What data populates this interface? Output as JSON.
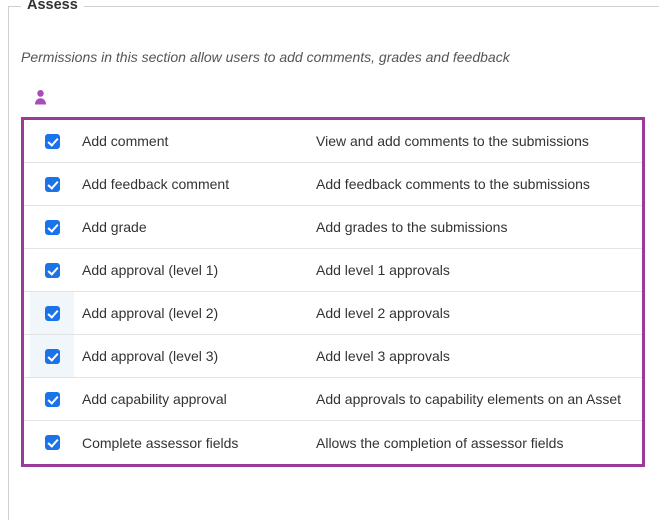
{
  "section": {
    "title": "Assess",
    "description": "Permissions in this section allow users to add comments, grades and feedback"
  },
  "roleIcon": "user-role-icon",
  "permissions": [
    {
      "checked": true,
      "name": "Add comment",
      "desc": "View and add comments to the submissions",
      "highlight": false
    },
    {
      "checked": true,
      "name": "Add feedback comment",
      "desc": "Add feedback comments to the submissions",
      "highlight": false
    },
    {
      "checked": true,
      "name": "Add grade",
      "desc": "Add grades to the submissions",
      "highlight": false
    },
    {
      "checked": true,
      "name": "Add approval (level 1)",
      "desc": "Add level 1 approvals",
      "highlight": false
    },
    {
      "checked": true,
      "name": "Add approval (level 2)",
      "desc": "Add level 2 approvals",
      "highlight": true
    },
    {
      "checked": true,
      "name": "Add approval (level 3)",
      "desc": "Add level 3 approvals",
      "highlight": true
    },
    {
      "checked": true,
      "name": "Add capability approval",
      "desc": "Add approvals to capability elements on an Asset",
      "highlight": false
    },
    {
      "checked": true,
      "name": "Complete assessor fields",
      "desc": "Allows the completion of assessor fields",
      "highlight": false
    }
  ]
}
